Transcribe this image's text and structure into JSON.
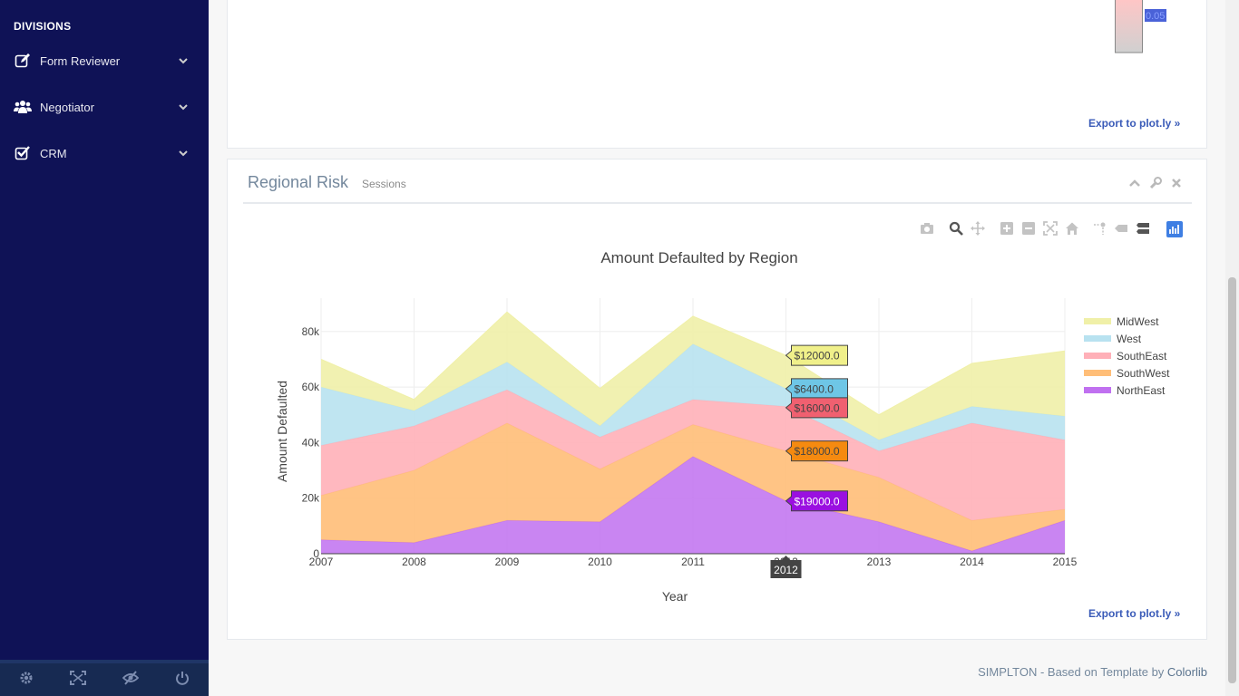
{
  "sidebar": {
    "section_title": "DIVISIONS",
    "items": [
      {
        "label": "Form Reviewer",
        "icon": "edit-icon"
      },
      {
        "label": "Negotiator",
        "icon": "users-icon"
      },
      {
        "label": "CRM",
        "icon": "checkbox-icon"
      }
    ],
    "footer_buttons": [
      "settings-icon",
      "fullscreen-icon",
      "eye-slash-icon",
      "power-icon"
    ]
  },
  "top_panel": {
    "export_label": "Export to plot.ly »",
    "colorbar_tick": "0.05"
  },
  "regional_panel": {
    "title": "Regional Risk",
    "subtitle": "Sessions",
    "export_label": "Export to plot.ly »"
  },
  "footer": {
    "text": "SIMPLTON - Based on Template by ",
    "link": "Colorlib"
  },
  "colors": {
    "sidebar_bg": "#0f1256",
    "MidWest": "#f0f0a8",
    "West": "#b8e2f0",
    "SouthEast": "#ffb0b8",
    "SouthWest": "#ffbe78",
    "NorthEast": "#c070f0"
  },
  "chart_data": {
    "type": "area",
    "title": "Amount Defaulted by Region",
    "xlabel": "Year",
    "ylabel": "Amount Defaulted",
    "x": [
      2007,
      2008,
      2009,
      2010,
      2011,
      2012,
      2013,
      2014,
      2015
    ],
    "xlim": [
      2007,
      2015
    ],
    "ylim": [
      0,
      92000
    ],
    "yticks": [
      0,
      20000,
      40000,
      60000,
      80000
    ],
    "ytick_labels": [
      "0",
      "20k",
      "40k",
      "60k",
      "80k"
    ],
    "stacked": true,
    "legend_position": "right",
    "series": [
      {
        "name": "NorthEast",
        "values": [
          5000,
          4000,
          12000,
          11500,
          35000,
          19000,
          11500,
          1000,
          12000
        ]
      },
      {
        "name": "SouthWest",
        "values": [
          16000,
          26000,
          35000,
          19000,
          11500,
          18000,
          16000,
          11000,
          4000
        ]
      },
      {
        "name": "SouthEast",
        "values": [
          18000,
          16000,
          12000,
          11500,
          9000,
          16000,
          9500,
          35000,
          25000
        ]
      },
      {
        "name": "West",
        "values": [
          21000,
          5500,
          10000,
          4000,
          20000,
          6400,
          4000,
          6000,
          8500
        ]
      },
      {
        "name": "MidWest",
        "values": [
          10000,
          4000,
          18000,
          13500,
          10000,
          12000,
          9000,
          15500,
          23500
        ]
      }
    ],
    "legend_order": [
      "MidWest",
      "West",
      "SouthEast",
      "SouthWest",
      "NorthEast"
    ],
    "hover": {
      "x": 2012,
      "x_label": "2012",
      "labels": [
        {
          "series": "MidWest",
          "text": "$12000.0"
        },
        {
          "series": "West",
          "text": "$6400.0"
        },
        {
          "series": "SouthEast",
          "text": "$16000.0"
        },
        {
          "series": "SouthWest",
          "text": "$18000.0"
        },
        {
          "series": "NorthEast",
          "text": "$19000.0"
        }
      ]
    }
  }
}
